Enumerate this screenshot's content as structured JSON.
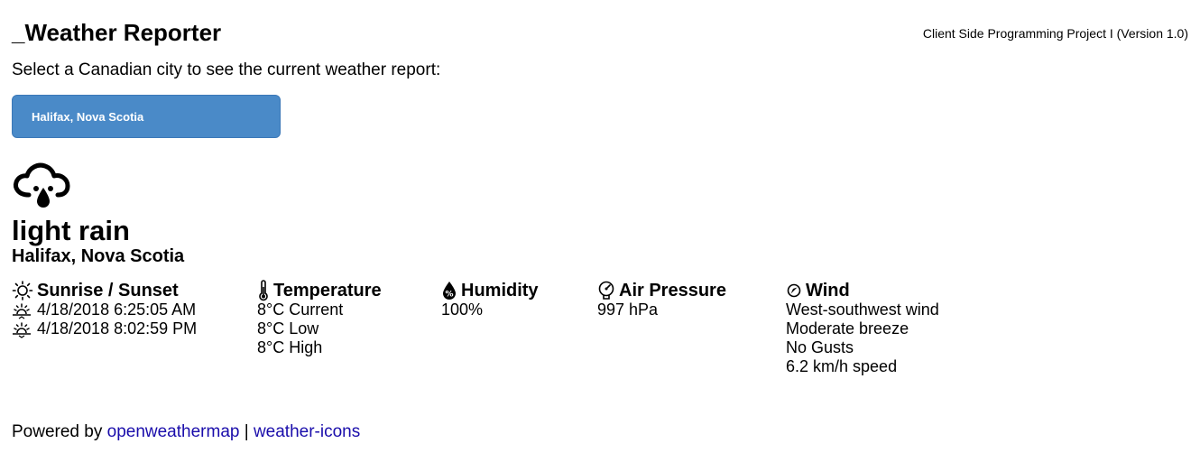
{
  "app": {
    "title": "_Weather Reporter",
    "version": "Client Side Programming Project I (Version 1.0)",
    "prompt": "Select a Canadian city to see the current weather report:"
  },
  "city_select": {
    "selected": "Halifax, Nova Scotia",
    "color": "#4a8ac8"
  },
  "current": {
    "icon": "rain-cloud-icon",
    "condition": "light rain",
    "location": "Halifax, Nova Scotia"
  },
  "sun": {
    "heading": "Sunrise / Sunset",
    "sunrise": "4/18/2018 6:25:05 AM",
    "sunset": "4/18/2018 8:02:59 PM"
  },
  "temperature": {
    "heading": "Temperature",
    "current": "8°C Current",
    "low": "8°C Low",
    "high": "8°C High"
  },
  "humidity": {
    "heading": "Humidity",
    "value": "100%"
  },
  "pressure": {
    "heading": "Air Pressure",
    "value": "997 hPa"
  },
  "wind": {
    "heading": "Wind",
    "direction": "West-southwest wind",
    "description": "Moderate breeze",
    "gusts": "No Gusts",
    "speed": "6.2 km/h speed"
  },
  "footer": {
    "prefix": "Powered by ",
    "link1": "openweathermap",
    "separator": " | ",
    "link2": "weather-icons",
    "link_color": "#1a0dab"
  }
}
